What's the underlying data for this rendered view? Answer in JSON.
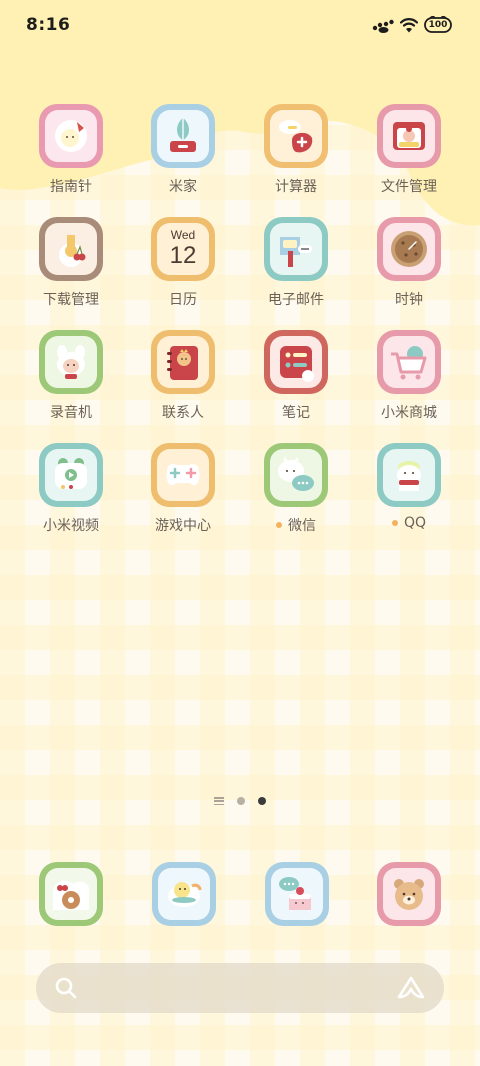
{
  "status_bar": {
    "time": "8:16",
    "battery": "100"
  },
  "apps": [
    {
      "label": "指南针",
      "icon": "compass-icon",
      "frame": "#e99ab0",
      "bg": "#fde7ee",
      "dot": false
    },
    {
      "label": "米家",
      "icon": "mi-home-icon",
      "frame": "#a9cfe4",
      "bg": "#eef7fc",
      "dot": false
    },
    {
      "label": "计算器",
      "icon": "calculator-icon",
      "frame": "#f0bf72",
      "bg": "#fff1d8",
      "dot": false
    },
    {
      "label": "文件管理",
      "icon": "file-manager-icon",
      "frame": "#e79aa9",
      "bg": "#fde6ea",
      "dot": false
    },
    {
      "label": "下载管理",
      "icon": "download-icon",
      "frame": "#a88b78",
      "bg": "#fbeee3",
      "dot": false
    },
    {
      "label": "日历",
      "icon": "calendar-icon",
      "frame": "#efbd6e",
      "bg": "#fff0d6",
      "dot": false,
      "day": "Wed",
      "date": "12"
    },
    {
      "label": "电子邮件",
      "icon": "email-icon",
      "frame": "#8ccac3",
      "bg": "#e7f6f3",
      "dot": false
    },
    {
      "label": "时钟",
      "icon": "clock-icon",
      "frame": "#e79aa9",
      "bg": "#fde6ea",
      "dot": false
    },
    {
      "label": "录音机",
      "icon": "recorder-icon",
      "frame": "#9cc878",
      "bg": "#eef7e4",
      "dot": false
    },
    {
      "label": "联系人",
      "icon": "contacts-icon",
      "frame": "#efbd6e",
      "bg": "#fff0d6",
      "dot": false
    },
    {
      "label": "笔记",
      "icon": "notes-icon",
      "frame": "#d0675e",
      "bg": "#fde9e6",
      "dot": false
    },
    {
      "label": "小米商城",
      "icon": "shop-cart-icon",
      "frame": "#e79aa9",
      "bg": "#fde6ea",
      "dot": false
    },
    {
      "label": "小米视频",
      "icon": "video-icon",
      "frame": "#8ccac3",
      "bg": "#e7f6f3",
      "dot": false
    },
    {
      "label": "游戏中心",
      "icon": "game-controller-icon",
      "frame": "#efbd6e",
      "bg": "#fff0d6",
      "dot": false
    },
    {
      "label": "微信",
      "icon": "wechat-icon",
      "frame": "#9cc878",
      "bg": "#eef7e4",
      "dot": true
    },
    {
      "label": "QQ",
      "icon": "qq-icon",
      "frame": "#8ccac3",
      "bg": "#e7f6f3",
      "dot": true
    }
  ],
  "dock": [
    {
      "icon": "phone-donut-icon",
      "frame": "#9cc878",
      "bg": "#f3f9ea"
    },
    {
      "icon": "browser-chick-icon",
      "frame": "#a9cfe4",
      "bg": "#eef7fc"
    },
    {
      "icon": "messages-cake-icon",
      "frame": "#a9cfe4",
      "bg": "#eef7fc"
    },
    {
      "icon": "camera-bear-icon",
      "frame": "#e79aa9",
      "bg": "#fde6ea"
    }
  ],
  "page_indicator": {
    "pages": 2,
    "active": 2
  },
  "colors": {
    "wave": "#fff0b3",
    "accent_dot": "#f4b25c"
  }
}
